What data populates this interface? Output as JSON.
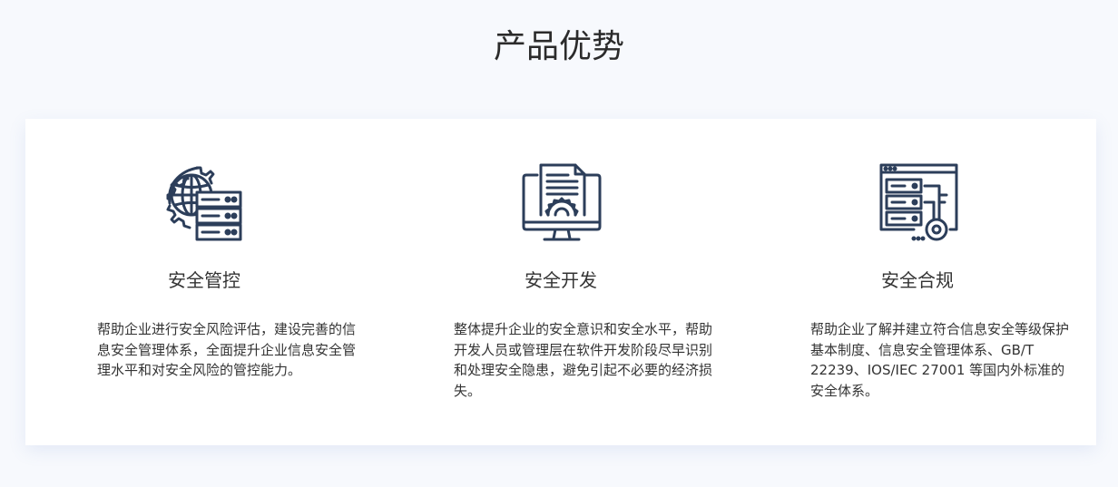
{
  "section": {
    "title": "产品优势"
  },
  "features": [
    {
      "icon": "globe-gear-server-icon",
      "title": "安全管控",
      "description": "帮助企业进行安全风险评估，建设完善的信息安全管理体系，全面提升企业信息安全管理水平和对安全风险的管控能力。"
    },
    {
      "icon": "monitor-document-gear-icon",
      "title": "安全开发",
      "description": "整体提升企业的安全意识和安全水平，帮助开发人员或管理层在软件开发阶段尽早识别和处理安全隐患，避免引起不必要的经济损失。"
    },
    {
      "icon": "server-key-icon",
      "title": "安全合规",
      "description": "帮助企业了解并建立符合信息安全等级保护基本制度、信息安全管理体系、GB/T 22239、IOS/IEC 27001 等国内外标准的安全体系。"
    }
  ],
  "colors": {
    "icon_stroke": "#2c3e5a",
    "page_background": "#f7f9fd",
    "card_background": "#ffffff",
    "text": "#333333"
  }
}
